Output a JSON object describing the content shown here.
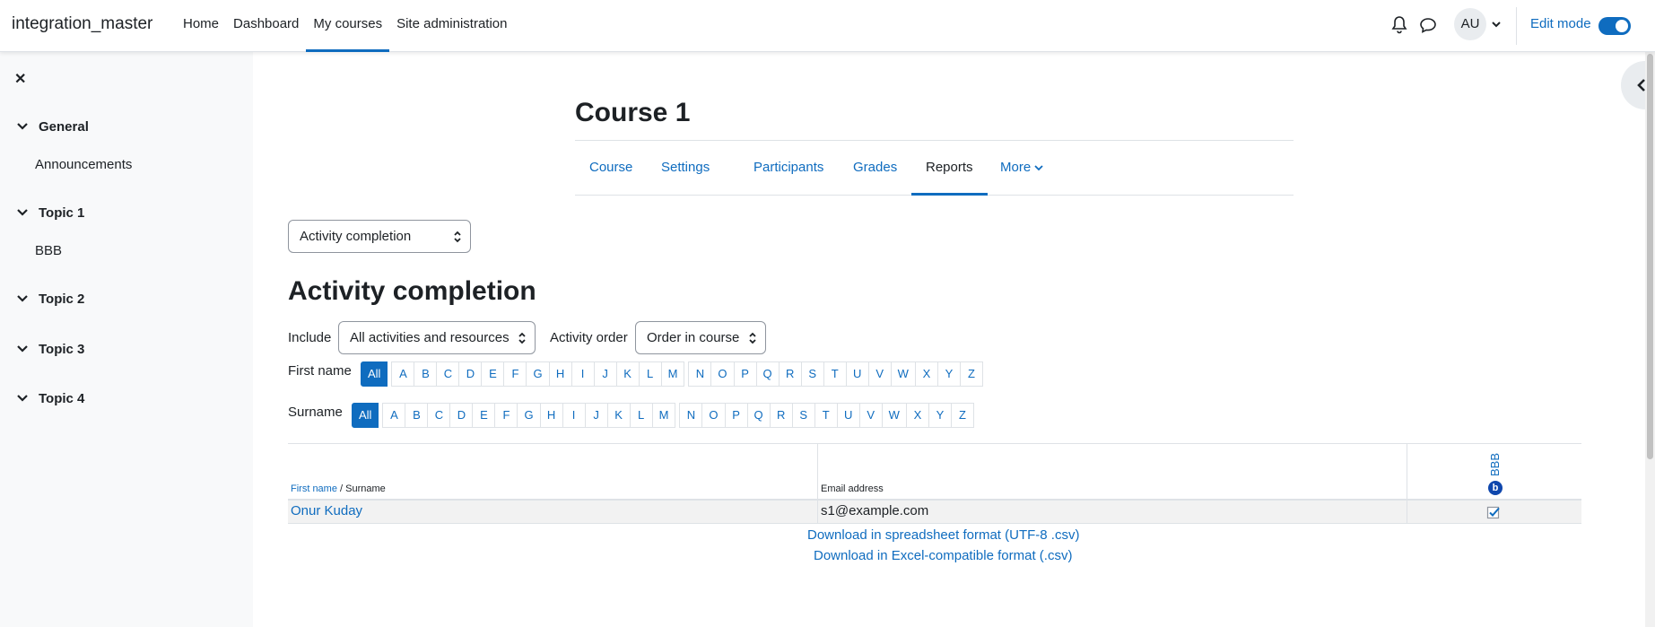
{
  "navbar": {
    "brand": "integration_master",
    "items": [
      {
        "label": "Home"
      },
      {
        "label": "Dashboard"
      },
      {
        "label": "My courses"
      },
      {
        "label": "Site administration"
      }
    ],
    "user_initials": "AU",
    "edit_mode_label": "Edit mode",
    "edit_mode_on": true,
    "icons": [
      "bell-icon",
      "chat-icon",
      "chevron-down-icon"
    ]
  },
  "drawer": {
    "sections": [
      {
        "title": "General",
        "activities": [
          "Announcements"
        ]
      },
      {
        "title": "Topic 1",
        "activities": [
          "BBB"
        ]
      },
      {
        "title": "Topic 2",
        "activities": []
      },
      {
        "title": "Topic 3",
        "activities": []
      },
      {
        "title": "Topic 4",
        "activities": []
      }
    ]
  },
  "course": {
    "title": "Course 1",
    "tabs": [
      {
        "label": "Course"
      },
      {
        "label": "Settings"
      },
      {
        "label": "Participants"
      },
      {
        "label": "Grades"
      },
      {
        "label": "Reports"
      },
      {
        "label": "More"
      }
    ],
    "active_tab": "Reports"
  },
  "report": {
    "selector_value": "Activity completion",
    "heading": "Activity completion",
    "include_label": "Include",
    "include_value": "All activities and resources",
    "order_label": "Activity order",
    "order_value": "Order in course",
    "firstname_label": "First name",
    "surname_label": "Surname",
    "initials_all": "All",
    "letters": [
      "A",
      "B",
      "C",
      "D",
      "E",
      "F",
      "G",
      "H",
      "I",
      "J",
      "K",
      "L",
      "M",
      "N",
      "O",
      "P",
      "Q",
      "R",
      "S",
      "T",
      "U",
      "V",
      "W",
      "X",
      "Y",
      "Z"
    ]
  },
  "table": {
    "col_firstname": "First name",
    "col_sep": " / ",
    "col_surname": "Surname",
    "col_email": "Email address",
    "activity_name": "BBB",
    "activity_badge": "b",
    "rows": [
      {
        "name": "Onur Kuday",
        "email": "s1@example.com",
        "completed": true
      }
    ]
  },
  "downloads": {
    "csv_utf8": "Download in spreadsheet format (UTF-8 .csv)",
    "csv_excel": "Download in Excel-compatible format (.csv)"
  },
  "colors": {
    "accent": "#0f6cbf",
    "text": "#1d2125",
    "drawer_bg": "#f8f9fa",
    "border": "#dee2e6"
  }
}
